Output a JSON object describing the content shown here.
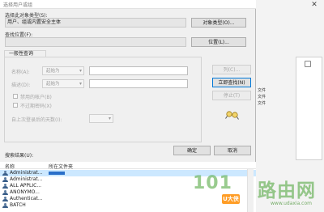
{
  "background_window": {
    "title": "",
    "list_rows": [
      "文件",
      "文件",
      "文件"
    ]
  },
  "dialog": {
    "title": "选择用户或组",
    "object_type": {
      "label": "选择此对象类型(S):",
      "value": "用户、组或内置安全主体",
      "button": "对象类型(O)..."
    },
    "location": {
      "label": "查找位置(F):",
      "value": "",
      "button": "位置(L)..."
    },
    "common_queries": {
      "tab": "一般性查询",
      "name_label": "名称(A):",
      "name_mode": "起始为",
      "desc_label": "描述(D):",
      "desc_mode": "起始为",
      "disabled_accounts": "禁用的帐户(B)",
      "no_expire_password": "不过期密码(X)",
      "days_since_logon": "自上次登录后的天数(I):",
      "columns_button": "列(C)...",
      "find_now_button": "立即查找(N)",
      "stop_button": "停止(T)"
    },
    "ok_button": "确定",
    "cancel_button": "取消",
    "search_results": {
      "label": "搜索结果(U):",
      "columns": [
        "名称",
        "所在文件夹"
      ],
      "rows": [
        {
          "name": "Administrat...",
          "selected": true
        },
        {
          "name": "Administrat...",
          "selected": false
        },
        {
          "name": "ALL APPLIC...",
          "selected": false
        },
        {
          "name": "ANONYMO...",
          "selected": false
        },
        {
          "name": "Authenticat...",
          "selected": false
        },
        {
          "name": "BATCH",
          "selected": false
        }
      ]
    }
  },
  "watermark": {
    "number": "101",
    "text": "路由网",
    "badge": "U大侠",
    "url": "www.udaxia.com"
  }
}
